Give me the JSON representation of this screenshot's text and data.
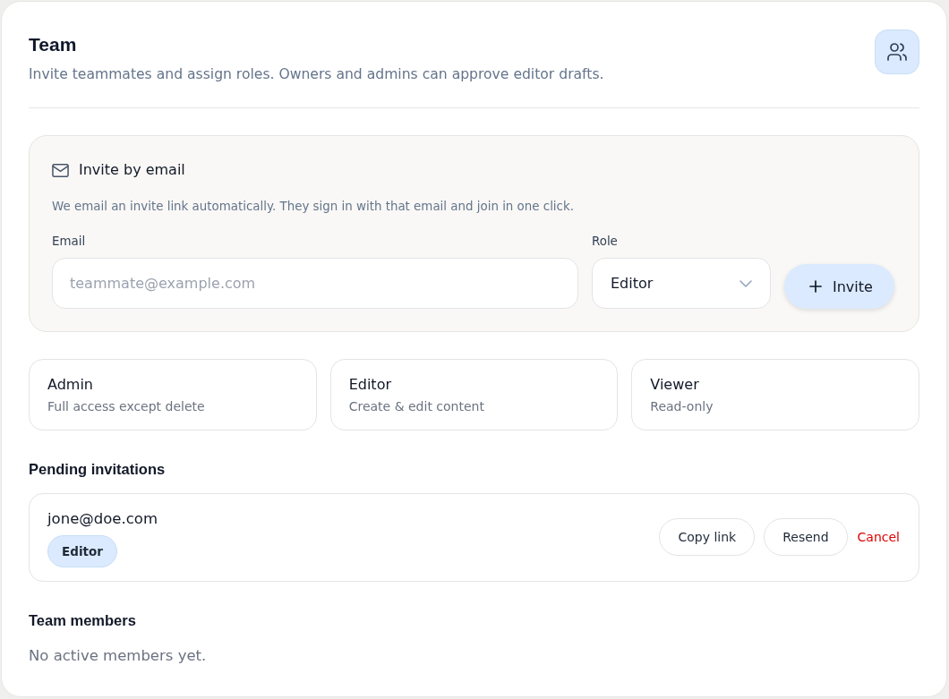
{
  "header": {
    "title": "Team",
    "subtitle": "Invite teammates and assign roles. Owners and admins can approve editor drafts."
  },
  "invite": {
    "title": "Invite by email",
    "description": "We email an invite link automatically. They sign in with that email and join in one click.",
    "email": {
      "label": "Email",
      "placeholder": "teammate@example.com"
    },
    "role": {
      "label": "Role",
      "value": "Editor"
    },
    "submit": "Invite"
  },
  "roles": [
    {
      "name": "Admin",
      "description": "Full access except delete"
    },
    {
      "name": "Editor",
      "description": "Create & edit content"
    },
    {
      "name": "Viewer",
      "description": "Read-only"
    }
  ],
  "pending": {
    "title": "Pending invitations",
    "invitations": [
      {
        "email": "jone@doe.com",
        "role": "Editor",
        "actions": [
          {
            "label": "Copy link",
            "kind": "outline"
          },
          {
            "label": "Resend",
            "kind": "outline"
          },
          {
            "label": "Cancel",
            "kind": "danger"
          }
        ]
      }
    ]
  },
  "members": {
    "title": "Team members",
    "empty_text": "No active members yet."
  }
}
